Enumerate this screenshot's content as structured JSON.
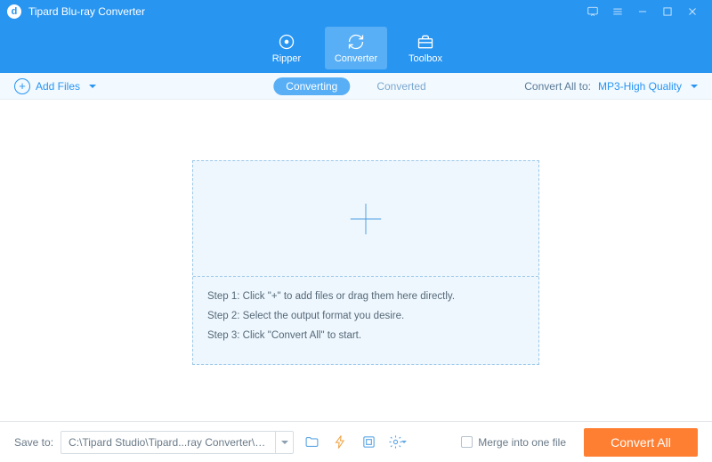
{
  "titlebar": {
    "app_name": "Tipard Blu-ray Converter"
  },
  "nav": {
    "ripper": "Ripper",
    "converter": "Converter",
    "toolbox": "Toolbox"
  },
  "toolbar": {
    "add_files": "Add Files",
    "tabs": {
      "converting": "Converting",
      "converted": "Converted"
    },
    "convert_all_to": "Convert All to:",
    "format": "MP3-High Quality"
  },
  "drop": {
    "step1": "Step 1: Click \"+\" to add files or drag them here directly.",
    "step2": "Step 2: Select the output format you desire.",
    "step3": "Step 3: Click \"Convert All\" to start."
  },
  "footer": {
    "save_to": "Save to:",
    "path": "C:\\Tipard Studio\\Tipard...ray Converter\\Converted",
    "merge": "Merge into one file",
    "convert_all": "Convert All"
  }
}
